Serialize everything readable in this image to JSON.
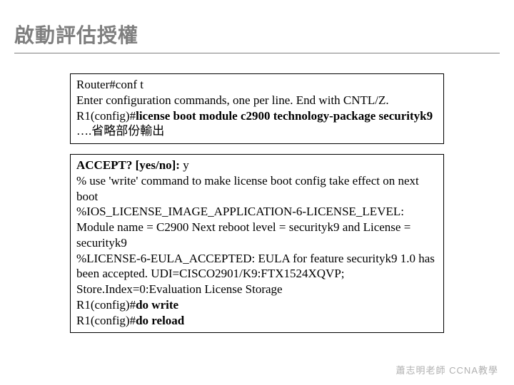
{
  "title": "啟動評估授權",
  "box1": {
    "l1a": "Router#",
    "l1b": "conf t",
    "l2": "Enter configuration commands, one per line.  End with CNTL/Z.",
    "l3a": "R1(config)#",
    "l3b": "license boot module c2900 technology-package securityk9",
    "l4": "….省略部份輸出"
  },
  "box2": {
    "l1a": "ACCEPT? [yes/no]: ",
    "l1b": "y",
    "l2": "% use 'write' command to make license boot config take effect on next boot",
    "l3": "%IOS_LICENSE_IMAGE_APPLICATION-6-LICENSE_LEVEL: Module name = C2900 Next reboot level = securityk9 and License = securityk9",
    "l4": "%LICENSE-6-EULA_ACCEPTED: EULA for feature securityk9 1.0 has been accepted. UDI=CISCO2901/K9:FTX1524XQVP; Store.Index=0:Evaluation License Storage",
    "l5a": "R1(config)#",
    "l5b": "do write",
    "l6a": "R1(config)#",
    "l6b": "do reload"
  },
  "footer": "蕭志明老師 CCNA教學"
}
